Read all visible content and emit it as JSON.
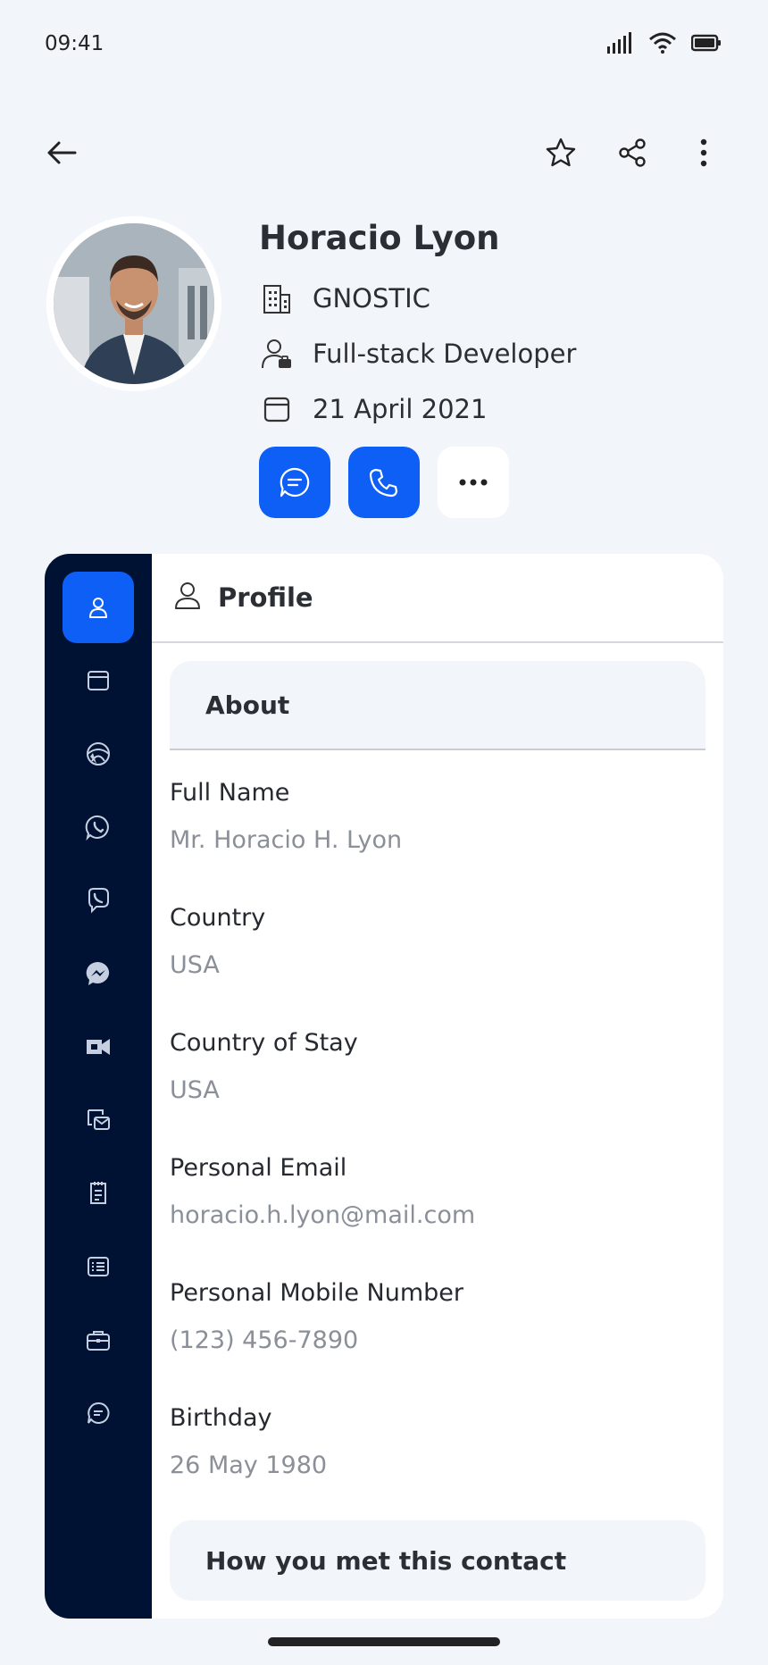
{
  "status_bar": {
    "time": "09:41"
  },
  "contact": {
    "name": "Horacio Lyon",
    "company": "GNOSTIC",
    "role": "Full-stack Developer",
    "date": "21 April 2021"
  },
  "colors": {
    "accent": "#0e5ff5",
    "sidebar": "#001233",
    "background": "#f2f5fa"
  },
  "side_nav": [
    "profile-icon",
    "calendar-icon",
    "globe-icon",
    "whatsapp-icon",
    "viber-icon",
    "messenger-icon",
    "video-icon",
    "email-chat-icon",
    "notes-icon",
    "list-icon",
    "briefcase-icon",
    "chat-icon"
  ],
  "panel": {
    "title": "Profile",
    "section_title": "About",
    "fields": [
      {
        "label": "Full Name",
        "value": "Mr. Horacio H. Lyon"
      },
      {
        "label": "Country",
        "value": "USA"
      },
      {
        "label": "Country of Stay",
        "value": "USA"
      },
      {
        "label": "Personal Email",
        "value": "horacio.h.lyon@mail.com"
      },
      {
        "label": "Personal Mobile Number",
        "value": "(123) 456-7890"
      },
      {
        "label": "Birthday",
        "value": "26 May 1980"
      }
    ],
    "met_title": "How you met this contact"
  }
}
